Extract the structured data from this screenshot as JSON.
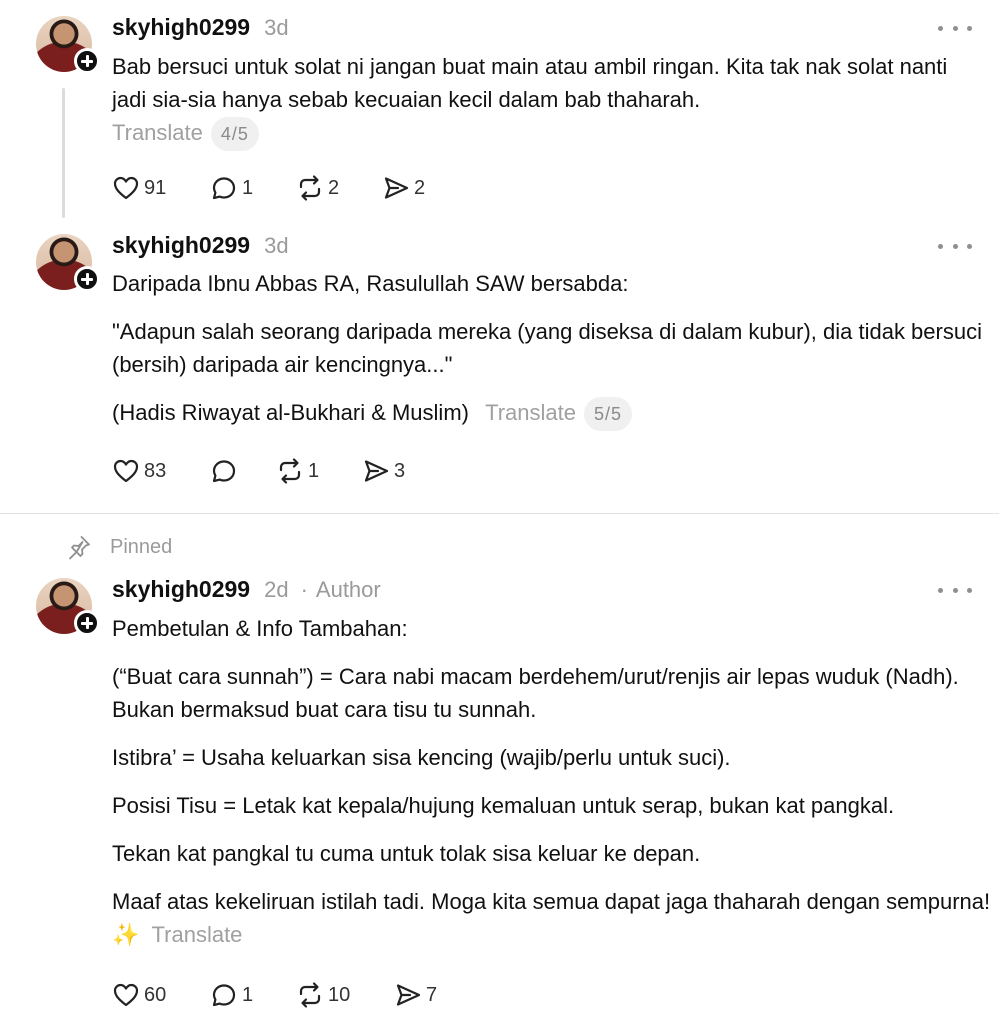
{
  "posts": [
    {
      "username": "skyhigh0299",
      "time": "3d",
      "body": [
        "Bab bersuci untuk solat ni jangan buat main atau ambil ringan. Kita tak nak solat nanti jadi sia-sia hanya sebab kecuaian kecil dalam bab thaharah."
      ],
      "translate_label": "Translate",
      "page_indicator": "4/5",
      "likes": "91",
      "replies": "1",
      "reposts": "2",
      "shares": "2"
    },
    {
      "username": "skyhigh0299",
      "time": "3d",
      "body": [
        "Daripada Ibnu Abbas RA, Rasulullah SAW bersabda:",
        "\"Adapun salah seorang daripada mereka (yang diseksa di dalam kubur), dia tidak bersuci (bersih) daripada air kencingnya...\"",
        "(Hadis Riwayat al-Bukhari & Muslim)"
      ],
      "translate_label": "Translate",
      "page_indicator": "5/5",
      "likes": "83",
      "replies": "",
      "reposts": "1",
      "shares": "3"
    },
    {
      "pinned_label": "Pinned",
      "username": "skyhigh0299",
      "time": "2d",
      "separator": "·",
      "author_label": "Author",
      "body": [
        "Pembetulan & Info Tambahan:",
        "(“Buat cara sunnah”) = Cara nabi macam berdehem/urut/renjis air lepas wuduk (Nadh). Bukan bermaksud buat cara tisu tu sunnah.",
        "Istibra’ = Usaha keluarkan sisa kencing (wajib/perlu untuk suci).",
        "Posisi Tisu = Letak kat kepala/hujung kemaluan untuk serap, bukan kat pangkal.",
        "Tekan kat pangkal tu cuma untuk tolak sisa keluar ke depan.",
        "Maaf atas kekeliruan istilah tadi. Moga kita semua dapat jaga thaharah dengan sempurna!"
      ],
      "sparkle": "✨",
      "translate_label": "Translate",
      "likes": "60",
      "replies": "1",
      "reposts": "10",
      "shares": "7"
    }
  ],
  "icons": {
    "like": "heart-icon",
    "reply": "comment-icon",
    "repost": "repost-icon",
    "share": "send-icon",
    "more": "more-icon",
    "pin": "pin-icon",
    "follow": "plus-icon"
  },
  "colors": {
    "muted": "#9a9a9a",
    "text": "#101010",
    "thread_line": "#dcdcdc"
  }
}
